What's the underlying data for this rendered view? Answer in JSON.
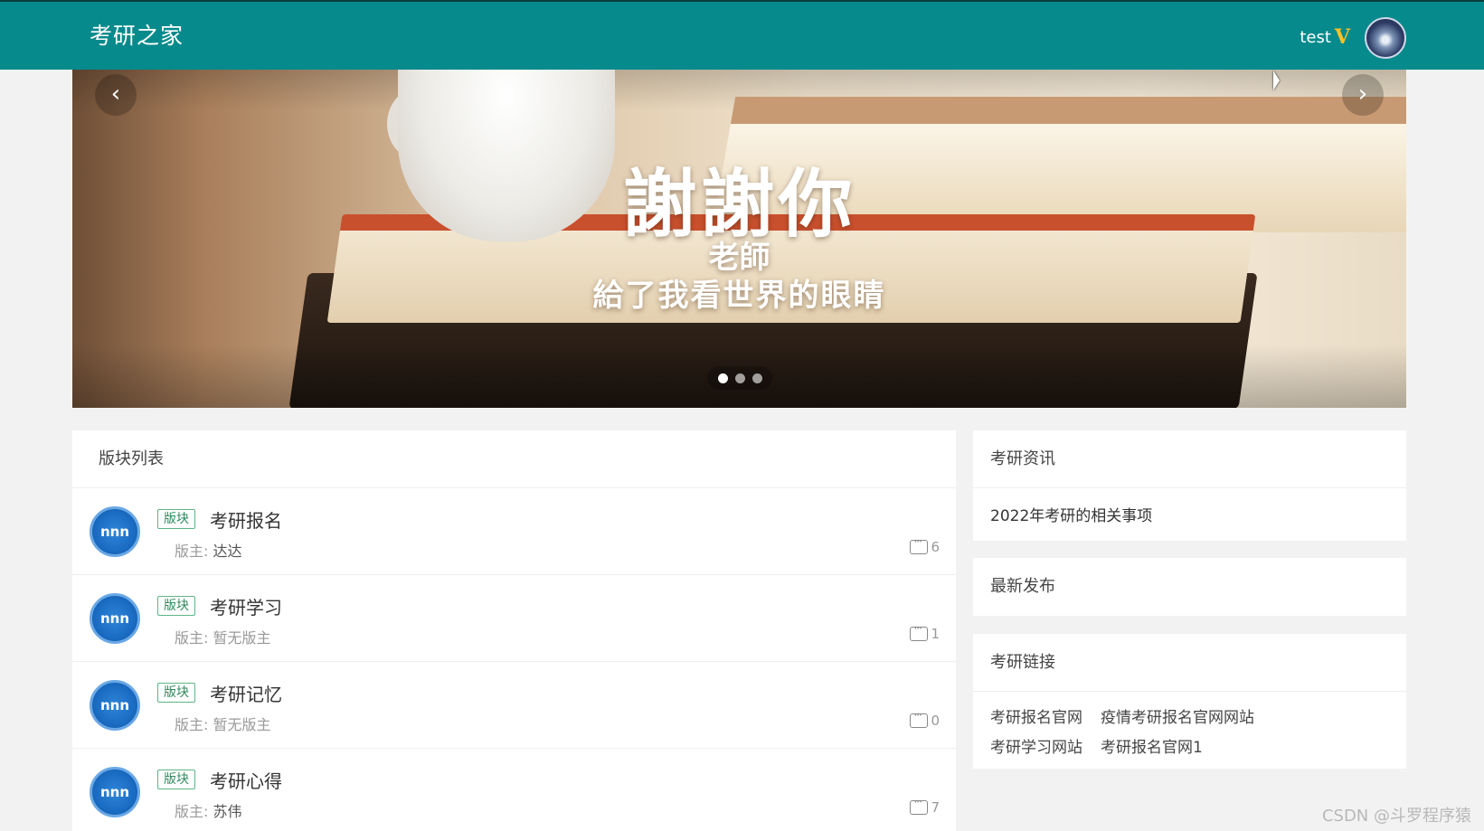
{
  "header": {
    "brand": "考研之家",
    "username": "test",
    "vip_badge": "V",
    "accent_color": "#078a8c"
  },
  "carousel": {
    "slogan_line1": "謝謝你",
    "slogan_line2": "老師",
    "slogan_line3": "給了我看世界的眼睛",
    "prev_icon": "chevron-left-icon",
    "next_icon": "chevron-right-icon",
    "slide_count": 3,
    "active_slide": 1
  },
  "boards": {
    "title": "版块列表",
    "tag_label": "版块",
    "moderator_label": "版主:",
    "items": [
      {
        "name": "考研报名",
        "moderator": "达达",
        "count": "6"
      },
      {
        "name": "考研学习",
        "moderator": "暂无版主",
        "count": "1"
      },
      {
        "name": "考研记忆",
        "moderator": "暂无版主",
        "count": "0"
      },
      {
        "name": "考研心得",
        "moderator": "苏伟",
        "count": "7"
      }
    ]
  },
  "news": {
    "title": "考研资讯",
    "items": [
      "2022年考研的相关事项"
    ]
  },
  "latest": {
    "title": "最新发布"
  },
  "links": {
    "title": "考研链接",
    "items": [
      "考研报名官网",
      "疫情考研报名官网网站",
      "考研学习网站",
      "考研报名官网1"
    ]
  },
  "watermark": "CSDN @斗罗程序猿"
}
